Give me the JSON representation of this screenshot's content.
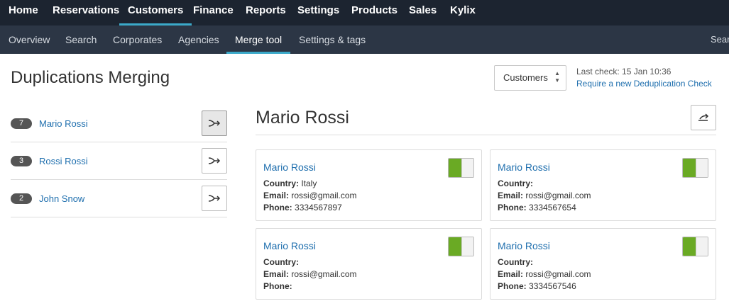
{
  "top_nav": [
    "Home",
    "Reservations",
    "Customers",
    "Finance",
    "Reports",
    "Settings",
    "Products",
    "Sales",
    "Kylix"
  ],
  "top_nav_active": "Customers",
  "sub_nav": [
    "Overview",
    "Search",
    "Corporates",
    "Agencies",
    "Merge tool",
    "Settings & tags"
  ],
  "sub_nav_active": "Merge tool",
  "sub_nav_search": "Searc",
  "page_title": "Duplications Merging",
  "entity_select": {
    "value": "Customers"
  },
  "last_check": {
    "label": "Last check:",
    "value": "15 Jan 10:36"
  },
  "require_link": "Require a new Deduplication Check",
  "duplicates": [
    {
      "count": "7",
      "name": "Mario Rossi"
    },
    {
      "count": "3",
      "name": "Rossi Rossi"
    },
    {
      "count": "2",
      "name": "John Snow"
    }
  ],
  "detail": {
    "title": "Mario Rossi",
    "labels": {
      "country": "Country:",
      "email": "Email:",
      "phone": "Phone:"
    },
    "records": [
      {
        "name": "Mario Rossi",
        "country": "Italy",
        "email": "rossi@gmail.com",
        "phone": "3334567897",
        "selected": true
      },
      {
        "name": "Mario Rossi",
        "country": "",
        "email": "rossi@gmail.com",
        "phone": "3334567654",
        "selected": true
      },
      {
        "name": "Mario Rossi",
        "country": "",
        "email": "rossi@gmail.com",
        "phone": "",
        "selected": true
      },
      {
        "name": "Mario Rossi",
        "country": "",
        "email": "rossi@gmail.com",
        "phone": "3334567546",
        "selected": true
      }
    ]
  },
  "colors": {
    "top_nav_bg": "#1c2430",
    "sub_nav_bg": "#2c3645",
    "accent": "#3ba9c9",
    "link": "#1f6fae",
    "toggle_on": "#6aaa24"
  }
}
